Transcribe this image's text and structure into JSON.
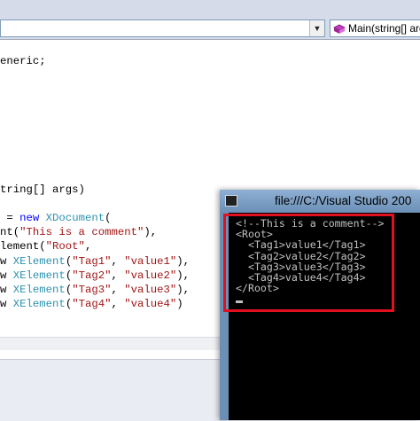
{
  "navbar": {
    "type_combo_value": "",
    "member_combo_value": "Main(string[] arg"
  },
  "code_lines": [
    {
      "parts": [
        {
          "t": "eneric;",
          "c": ""
        }
      ]
    },
    {
      "parts": [
        {
          "t": "tring[] args)",
          "c": ""
        }
      ]
    },
    {
      "parts": [
        {
          "t": " = ",
          "c": ""
        },
        {
          "t": "new",
          "c": "kw"
        },
        {
          "t": " ",
          "c": ""
        },
        {
          "t": "XDocument",
          "c": "ty"
        },
        {
          "t": "(",
          "c": ""
        }
      ]
    },
    {
      "parts": [
        {
          "t": "nt(",
          "c": ""
        },
        {
          "t": "\"This is a comment\"",
          "c": "st"
        },
        {
          "t": "),",
          "c": ""
        }
      ]
    },
    {
      "parts": [
        {
          "t": "lement(",
          "c": ""
        },
        {
          "t": "\"Root\"",
          "c": "st"
        },
        {
          "t": ",",
          "c": ""
        }
      ]
    },
    {
      "parts": [
        {
          "t": "w ",
          "c": ""
        },
        {
          "t": "XElement",
          "c": "ty"
        },
        {
          "t": "(",
          "c": ""
        },
        {
          "t": "\"Tag1\"",
          "c": "st"
        },
        {
          "t": ", ",
          "c": ""
        },
        {
          "t": "\"value1\"",
          "c": "st"
        },
        {
          "t": "),",
          "c": ""
        }
      ]
    },
    {
      "parts": [
        {
          "t": "w ",
          "c": ""
        },
        {
          "t": "XElement",
          "c": "ty"
        },
        {
          "t": "(",
          "c": ""
        },
        {
          "t": "\"Tag2\"",
          "c": "st"
        },
        {
          "t": ", ",
          "c": ""
        },
        {
          "t": "\"value2\"",
          "c": "st"
        },
        {
          "t": "),",
          "c": ""
        }
      ]
    },
    {
      "parts": [
        {
          "t": "w ",
          "c": ""
        },
        {
          "t": "XElement",
          "c": "ty"
        },
        {
          "t": "(",
          "c": ""
        },
        {
          "t": "\"Tag3\"",
          "c": "st"
        },
        {
          "t": ", ",
          "c": ""
        },
        {
          "t": "\"value3\"",
          "c": "st"
        },
        {
          "t": "),",
          "c": ""
        }
      ]
    },
    {
      "parts": [
        {
          "t": "w ",
          "c": ""
        },
        {
          "t": "XElement",
          "c": "ty"
        },
        {
          "t": "(",
          "c": ""
        },
        {
          "t": "\"Tag4\"",
          "c": "st"
        },
        {
          "t": ", ",
          "c": ""
        },
        {
          "t": "\"value4\"",
          "c": "st"
        },
        {
          "t": ")",
          "c": ""
        }
      ]
    }
  ],
  "console": {
    "title": "file:///C:/Visual Studio 200",
    "lines": [
      "<!--This is a comment-->",
      "<Root>",
      "  <Tag1>value1</Tag1>",
      "  <Tag2>value2</Tag2>",
      "  <Tag3>value3</Tag3>",
      "  <Tag4>value4</Tag4>",
      "</Root>"
    ]
  },
  "colors": {
    "keyword": "#0000ff",
    "type": "#2b91af",
    "string": "#a31515",
    "highlight": "#e0101e",
    "console_bg": "#000000",
    "console_text": "#c0c0c0"
  },
  "icons": [
    "chevron-down-icon",
    "method-icon",
    "console-app-icon"
  ]
}
